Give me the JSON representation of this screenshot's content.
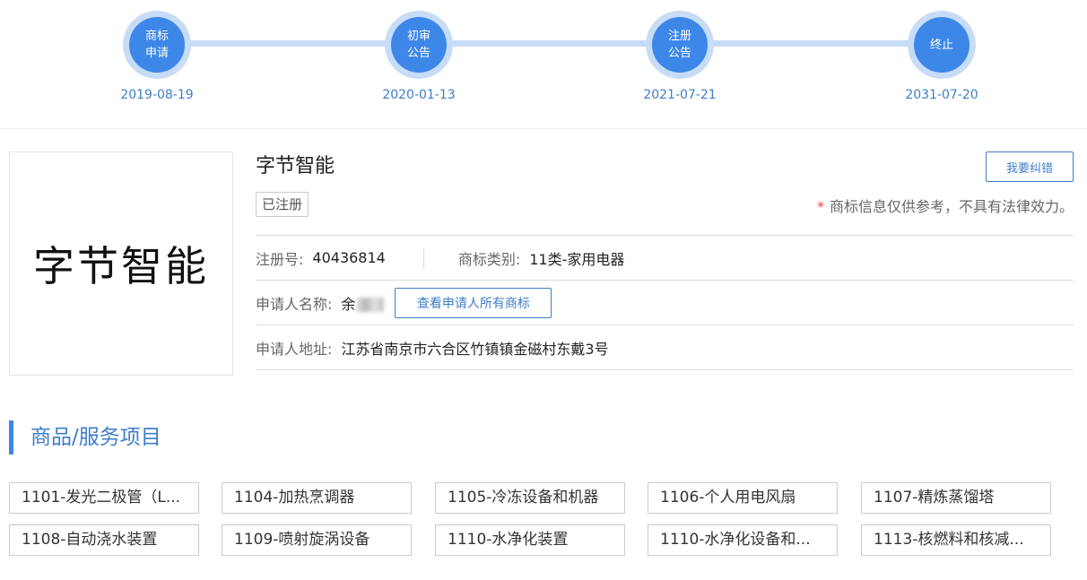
{
  "timeline": {
    "steps": [
      {
        "label": "商标\n申请",
        "date": "2019-08-19"
      },
      {
        "label": "初审\n公告",
        "date": "2020-01-13"
      },
      {
        "label": "注册\n公告",
        "date": "2021-07-21"
      },
      {
        "label": "终止",
        "date": "2031-07-20"
      }
    ]
  },
  "brand": {
    "logo_text": "字节智能",
    "name": "字节智能",
    "status": "已注册",
    "correct_button": "我要纠错",
    "disclaimer_star": "*",
    "disclaimer": "商标信息仅供参考，不具有法律效力。"
  },
  "details": {
    "reg_no_label": "注册号:",
    "reg_no": "40436814",
    "category_label": "商标类别:",
    "category": "11类-家用电器",
    "applicant_label": "申请人名称:",
    "applicant_name": "余",
    "view_all_button": "查看申请人所有商标",
    "address_label": "申请人地址:",
    "address": "江苏省南京市六合区竹镇镇金磁村东戴3号"
  },
  "goods": {
    "title": "商品/服务项目",
    "items": [
      "1101-发光二极管（L...",
      "1104-加热烹调器",
      "1105-冷冻设备和机器",
      "1106-个人用电风扇",
      "1107-精炼蒸馏塔",
      "1108-自动浇水装置",
      "1109-喷射旋涡设备",
      "1110-水净化装置",
      "1110-水净化设备和...",
      "1113-核燃料和核减..."
    ]
  }
}
